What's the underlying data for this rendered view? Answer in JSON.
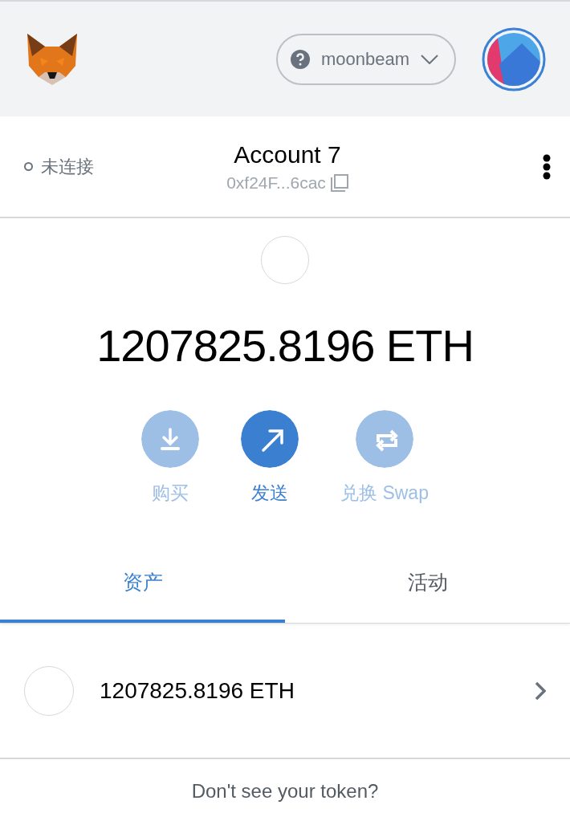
{
  "header": {
    "network": "moonbeam"
  },
  "account": {
    "status": "未连接",
    "connected": false,
    "name": "Account 7",
    "address": "0xf24F...6cac"
  },
  "balance": "1207825.8196 ETH",
  "actions": [
    {
      "kind": "buy",
      "label": "购买",
      "disabled": true
    },
    {
      "kind": "send",
      "label": "发送",
      "disabled": false
    },
    {
      "kind": "swap",
      "label": "兑换 Swap",
      "disabled": true
    }
  ],
  "tabs": [
    {
      "label": "资产",
      "selected": true
    },
    {
      "label": "活动",
      "selected": false
    }
  ],
  "assets": [
    {
      "amount": "1207825.8196 ETH"
    }
  ],
  "footer": {
    "prompt": "Don't see your token?"
  }
}
